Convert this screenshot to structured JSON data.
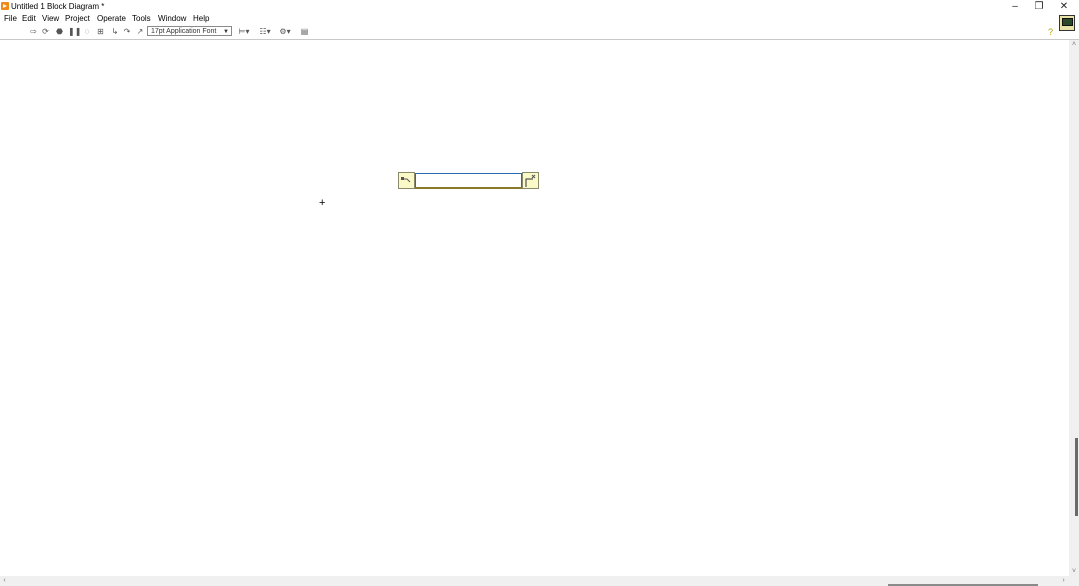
{
  "window": {
    "title": "Untitled 1 Block Diagram *",
    "controls": {
      "minimize": "–",
      "restore": "❐",
      "close": "✕"
    }
  },
  "menu": {
    "items": [
      "File",
      "Edit",
      "View",
      "Project",
      "Operate",
      "Tools",
      "Window",
      "Help"
    ]
  },
  "toolbar": {
    "font_select_value": "17pt Application Font",
    "help_glyph": "?"
  },
  "icons": {
    "run": "run-arrow-icon",
    "run_continuously": "run-continuously-icon",
    "abort": "abort-icon",
    "pause": "pause-icon",
    "highlight": "highlight-execution-icon",
    "retain_wire": "retain-wire-values-icon",
    "step_into": "step-into-icon",
    "step_over": "step-over-icon",
    "step_out": "step-out-icon",
    "align": "align-objects-icon",
    "distribute": "distribute-objects-icon",
    "reorder": "reorder-icon",
    "cleanup": "cleanup-diagram-icon",
    "help": "context-help-icon",
    "vi": "vi-icon"
  },
  "scrollbars": {
    "up": "˄",
    "down": "˅",
    "left": "‹",
    "right": "›"
  },
  "canvas": {
    "cursor": "+"
  },
  "colors": {
    "node_fill": "#fafac8",
    "string_border": "#2a6ab0",
    "app_accent": "#f08a18"
  }
}
